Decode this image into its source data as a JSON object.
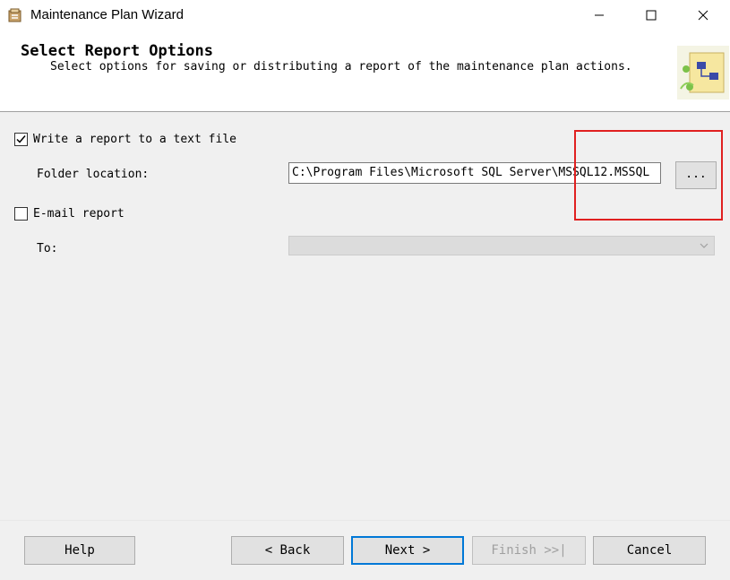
{
  "window": {
    "title": "Maintenance Plan Wizard",
    "controls": {
      "minimize": "minimize-icon",
      "maximize": "maximize-icon",
      "close": "close-icon"
    }
  },
  "header": {
    "title": "Select Report Options",
    "subtitle": "Select options for saving or distributing a report of the maintenance plan actions."
  },
  "form": {
    "write_report": {
      "label": "Write a report to a text file",
      "checked": true
    },
    "folder_location": {
      "label": "Folder location:",
      "value": "C:\\Program Files\\Microsoft SQL Server\\MSSQL12.MSSQL",
      "browse_label": "..."
    },
    "email_report": {
      "label": "E-mail report",
      "checked": false
    },
    "to": {
      "label": "To:",
      "value": "",
      "enabled": false
    }
  },
  "buttons": {
    "help": "Help",
    "back": "< Back",
    "next": "Next >",
    "finish": "Finish >>|",
    "cancel": "Cancel"
  },
  "colors": {
    "annotation_box": "#e02020",
    "default_button_border": "#0078d7"
  }
}
